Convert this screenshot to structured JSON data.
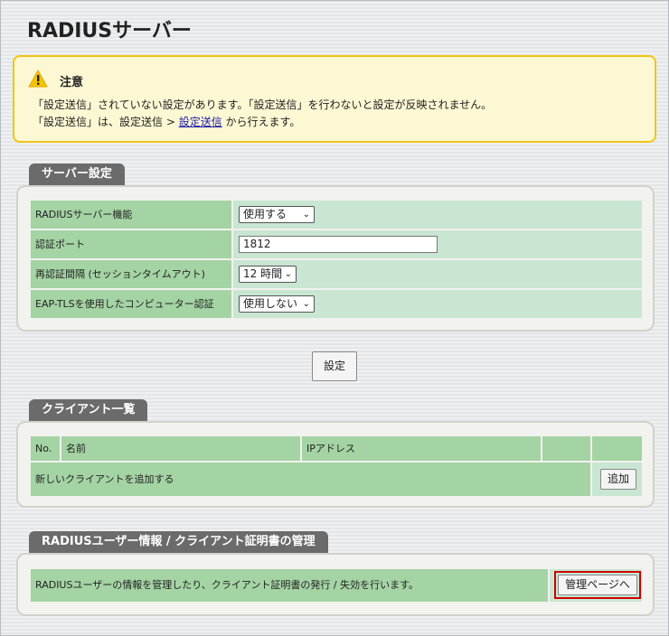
{
  "page": {
    "title": "RADIUSサーバー"
  },
  "notice": {
    "heading": "注意",
    "line1": "「設定送信」されていない設定があります。「設定送信」を行わないと設定が反映されません。",
    "line2_prefix": "「設定送信」は、設定送信 > ",
    "line2_link": "設定送信",
    "line2_suffix": " から行えます。"
  },
  "server_settings": {
    "tab": "サーバー設定",
    "rows": [
      {
        "label": "RADIUSサーバー機能",
        "value": "使用する"
      },
      {
        "label": "認証ポート",
        "value": "1812"
      },
      {
        "label": "再認証間隔 (セッションタイムアウト)",
        "value": "12 時間"
      },
      {
        "label": "EAP-TLSを使用したコンピューター認証",
        "value": "使用しない"
      }
    ],
    "submit_label": "設定"
  },
  "clients": {
    "tab": "クライアント一覧",
    "columns": [
      "No.",
      "名前",
      "IPアドレス",
      "",
      ""
    ],
    "add_row_text": "新しいクライアントを追加する",
    "add_button": "追加"
  },
  "user_mgmt": {
    "tab": "RADIUSユーザー情報 / クライアント証明書の管理",
    "description": "RADIUSユーザーの情報を管理したり、クライアント証明書の発行 / 失効を行います。",
    "button": "管理ページへ"
  },
  "icons": {
    "warning": "warning-triangle-icon",
    "select": "chevron-down-icon"
  },
  "colors": {
    "header_green": "#a4d3a4",
    "value_green": "#c8e6d2",
    "notice_border": "#f2c418",
    "highlight": "#d00000"
  }
}
